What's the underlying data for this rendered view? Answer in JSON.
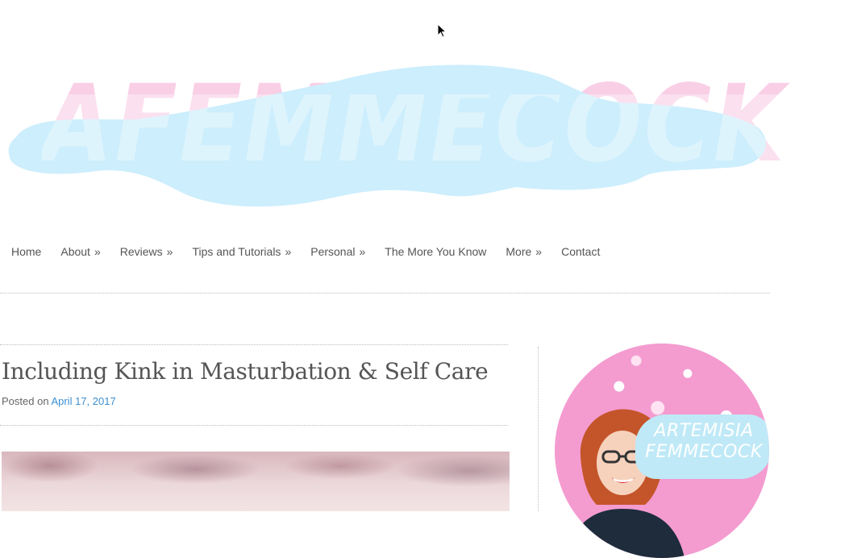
{
  "header": {
    "logo_text": "AFEMMECOCK",
    "colors": {
      "logo_text": "#f9cfe6",
      "cloud": "#cdeefc"
    }
  },
  "nav": {
    "items": [
      {
        "label": "Home",
        "has_submenu": false
      },
      {
        "label": "About",
        "has_submenu": true
      },
      {
        "label": "Reviews",
        "has_submenu": true
      },
      {
        "label": "Tips and Tutorials",
        "has_submenu": true
      },
      {
        "label": "Personal",
        "has_submenu": true
      },
      {
        "label": "The More You Know",
        "has_submenu": false
      },
      {
        "label": "More",
        "has_submenu": true
      },
      {
        "label": "Contact",
        "has_submenu": false
      }
    ],
    "submenu_indicator": "»"
  },
  "post": {
    "title": "Including Kink in Masturbation & Self Care",
    "meta_prefix": "Posted on",
    "date": "April 17, 2017",
    "colors": {
      "link": "#3b8fd1"
    }
  },
  "sidebar": {
    "avatar_line1": "ARTEMISIA",
    "avatar_line2": "FEMMECOCK",
    "colors": {
      "background": "#f49bd0",
      "badge": "#bfe9f7"
    }
  },
  "icons": {
    "cursor": "arrow-cursor-icon"
  }
}
